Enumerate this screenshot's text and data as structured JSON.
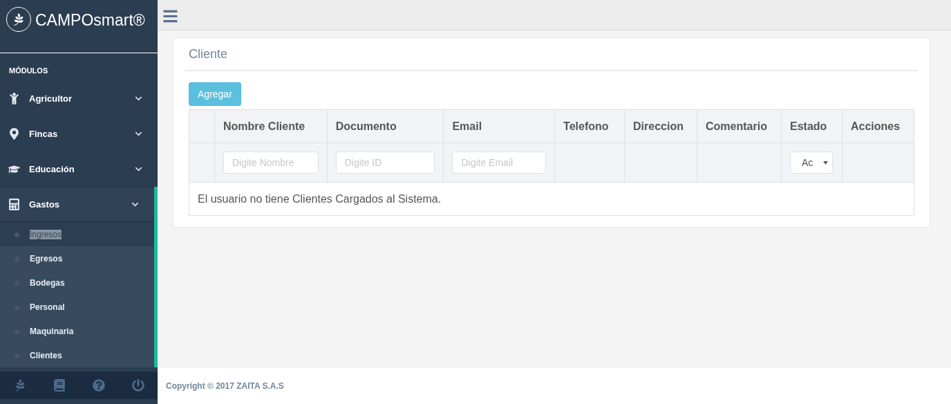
{
  "brand": {
    "name": "CAMPOsmart®"
  },
  "sidebar": {
    "heading": "MÓDULOS",
    "items": [
      {
        "label": "Agricultor",
        "expanded": false
      },
      {
        "label": "Fincas",
        "expanded": false
      },
      {
        "label": "Educación",
        "expanded": false
      },
      {
        "label": "Gastos",
        "expanded": true,
        "children": [
          {
            "label": "Ingresos",
            "selected": true
          },
          {
            "label": "Egresos",
            "selected": false
          },
          {
            "label": "Bodegas",
            "selected": false
          },
          {
            "label": "Personal",
            "selected": false
          },
          {
            "label": "Maquinaria",
            "selected": false
          },
          {
            "label": "Clientes",
            "selected": false
          }
        ]
      }
    ]
  },
  "card": {
    "title": "Cliente",
    "add_button": "Agregar",
    "table": {
      "columns": [
        "",
        "Nombre Cliente",
        "Documento",
        "Email",
        "Telefono",
        "Direccion",
        "Comentario",
        "Estado",
        "Acciones"
      ],
      "filters": [
        {
          "kind": "empty"
        },
        {
          "kind": "input",
          "placeholder": "Digite Nombre"
        },
        {
          "kind": "input",
          "placeholder": "Digite ID"
        },
        {
          "kind": "input",
          "placeholder": "Digite Email"
        },
        {
          "kind": "empty"
        },
        {
          "kind": "empty"
        },
        {
          "kind": "empty"
        },
        {
          "kind": "select",
          "value": "Ac"
        },
        {
          "kind": "empty"
        }
      ],
      "empty_message": "El usuario no tiene Clientes Cargados al Sistema."
    }
  },
  "footer": {
    "text": "Copyright © 2017 ZAITA S.A.S"
  }
}
